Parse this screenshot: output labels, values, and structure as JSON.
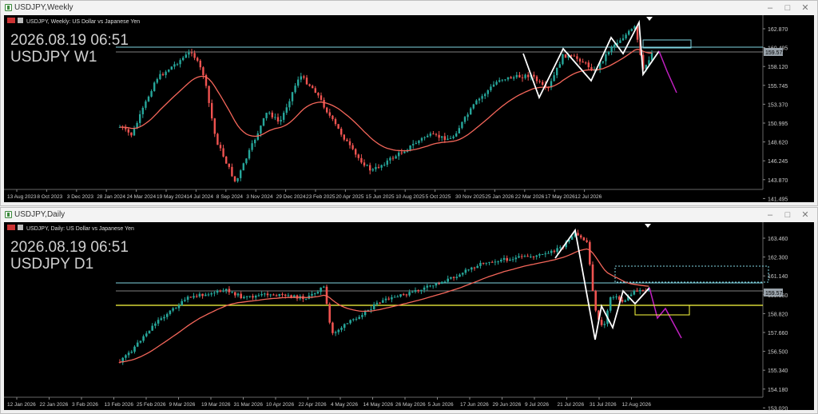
{
  "charts": [
    {
      "id": "weekly",
      "window_title": "USDJPY,Weekly",
      "header": "USDJPY, Weekly:  US Dollar vs Japanese Yen",
      "big_date": "2026.08.19 06:51",
      "big_symbol": "USDJPY W1",
      "price_ticks": [
        "162.870",
        "160.495",
        "158.120",
        "155.745",
        "153.370",
        "150.995",
        "148.620",
        "146.245",
        "143.870",
        "141.495"
      ],
      "current_price": "159.572",
      "time_labels": [
        "13 Aug 2023",
        "8 Oct 2023",
        "3 Dec 2023",
        "28 Jan 2024",
        "24 Mar 2024",
        "19 May 2024",
        "14 Jul 2024",
        "8 Sep 2024",
        "3 Nov 2024",
        "29 Dec 2024",
        "23 Feb 2025",
        "20 Apr 2025",
        "15 Jun 2025",
        "10 Aug 2025",
        "5 Oct 2025",
        "30 Nov 2025",
        "25 Jan 2026",
        "22 Mar 2026",
        "17 May 2026",
        "12 Jul 2026"
      ],
      "colors": {
        "bull": "#26a69a",
        "bear": "#ef5350",
        "ma": "#f4665a",
        "zigzag": "#ffffff",
        "projection": "#c020c0",
        "hline": "#7fd3e0"
      }
    },
    {
      "id": "daily",
      "window_title": "USDJPY,Daily",
      "header": "USDJPY, Daily:  US Dollar vs Japanese Yen",
      "big_date": "2026.08.19 06:51",
      "big_symbol": "USDJPY D1",
      "price_ticks": [
        "163.460",
        "162.300",
        "161.140",
        "159.980",
        "158.820",
        "157.660",
        "156.500",
        "155.340",
        "154.180",
        "153.020"
      ],
      "current_price": "159.572",
      "time_labels": [
        "12 Jan 2026",
        "22 Jan 2026",
        "3 Feb 2026",
        "13 Feb 2026",
        "25 Feb 2026",
        "9 Mar 2026",
        "19 Mar 2026",
        "31 Mar 2026",
        "10 Apr 2026",
        "22 Apr 2026",
        "4 May 2026",
        "14 May 2026",
        "26 May 2026",
        "5 Jun 2026",
        "17 Jun 2026",
        "29 Jun 2026",
        "9 Jul 2026",
        "21 Jul 2026",
        "31 Jul 2026",
        "12 Aug 2026"
      ],
      "colors": {
        "bull": "#26a69a",
        "bear": "#ef5350",
        "ma": "#f4665a",
        "zigzag": "#ffffff",
        "projection": "#c020c0",
        "hline": "#7fd3e0",
        "yellow": "#ffff40"
      }
    }
  ]
}
